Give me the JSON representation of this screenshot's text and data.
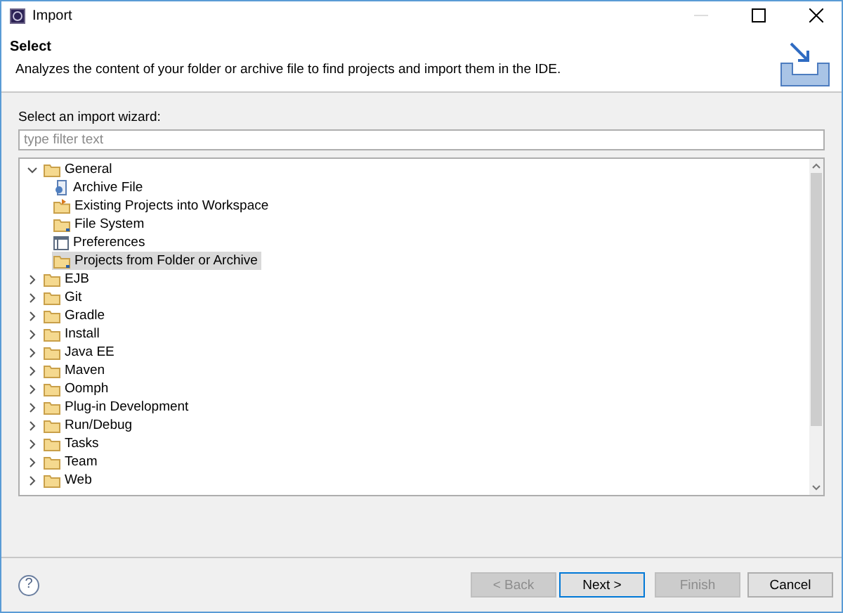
{
  "window": {
    "title": "Import"
  },
  "header": {
    "title": "Select",
    "description": "Analyzes the content of your folder or archive file to find projects and import them in the IDE."
  },
  "wizard_label": "Select an import wizard:",
  "filter": {
    "placeholder": "type filter text"
  },
  "tree": [
    {
      "label": "General",
      "expanded": true,
      "selected": false,
      "children": [
        {
          "label": "Archive File",
          "kind": "archive",
          "selected": false
        },
        {
          "label": "Existing Projects into Workspace",
          "kind": "project",
          "selected": false
        },
        {
          "label": "File System",
          "kind": "folder",
          "selected": false
        },
        {
          "label": "Preferences",
          "kind": "preferences",
          "selected": false
        },
        {
          "label": "Projects from Folder or Archive",
          "kind": "folder",
          "selected": true
        }
      ]
    },
    {
      "label": "EJB",
      "expanded": false,
      "selected": false
    },
    {
      "label": "Git",
      "expanded": false,
      "selected": false
    },
    {
      "label": "Gradle",
      "expanded": false,
      "selected": false
    },
    {
      "label": "Install",
      "expanded": false,
      "selected": false
    },
    {
      "label": "Java EE",
      "expanded": false,
      "selected": false
    },
    {
      "label": "Maven",
      "expanded": false,
      "selected": false
    },
    {
      "label": "Oomph",
      "expanded": false,
      "selected": false
    },
    {
      "label": "Plug-in Development",
      "expanded": false,
      "selected": false
    },
    {
      "label": "Run/Debug",
      "expanded": false,
      "selected": false
    },
    {
      "label": "Tasks",
      "expanded": false,
      "selected": false
    },
    {
      "label": "Team",
      "expanded": false,
      "selected": false
    },
    {
      "label": "Web",
      "expanded": false,
      "selected": false
    }
  ],
  "help": {
    "label": "?"
  },
  "buttons": [
    {
      "label": "< Back",
      "disabled": true,
      "default": false
    },
    {
      "label": "Next >",
      "disabled": false,
      "default": true
    },
    {
      "label": "Finish",
      "disabled": true,
      "default": false
    },
    {
      "label": "Cancel",
      "disabled": false,
      "default": false
    }
  ]
}
